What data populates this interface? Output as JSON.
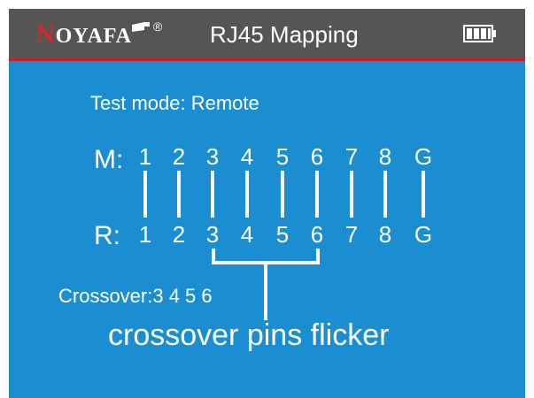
{
  "header": {
    "logo_first_letter": "N",
    "logo_rest": "OYAFA",
    "logo_reg": "®",
    "title": "RJ45  Mapping",
    "battery_icon": "battery-full-icon"
  },
  "colors": {
    "background": "#1a8ed1",
    "header": "#555555",
    "header_rule": "#c8202a",
    "logo_red": "#d6262e",
    "text": "#ffffff"
  },
  "screen": {
    "test_mode": "Test mode: Remote",
    "main_label": "M:",
    "remote_label": "R:",
    "main_pins": [
      "1",
      "2",
      "3",
      "4",
      "5",
      "6",
      "7",
      "8",
      "G"
    ],
    "remote_pins": [
      "1",
      "2",
      "3",
      "4",
      "5",
      "6",
      "7",
      "8",
      "G"
    ],
    "crossover_text": "Crossover:3 4 5 6",
    "crossover_pins": [
      "3",
      "4",
      "5",
      "6"
    ]
  },
  "annotation": {
    "note": "crossover pins flicker"
  }
}
